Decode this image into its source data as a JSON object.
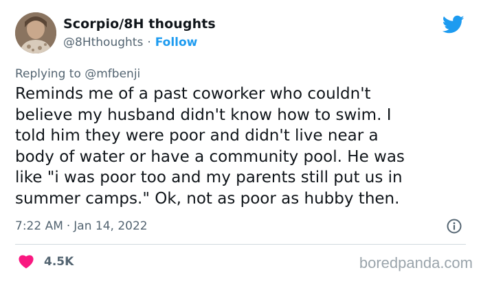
{
  "author": {
    "display_name": "Scorpio/8H thoughts",
    "handle": "@8Hthoughts",
    "separator": "·",
    "follow_label": "Follow",
    "avatar_icon": "profile-avatar"
  },
  "brand": {
    "icon": "twitter-bird-icon",
    "color": "#1d9bf0"
  },
  "reply_context": {
    "prefix": "Replying to",
    "mention": "@mfbenji"
  },
  "tweet": {
    "lines": [
      "Reminds me of a past coworker who couldn't",
      "believe my husband didn't know how to swim. I",
      "told him they were poor and didn't live near a",
      "body of water or have a community pool. He was",
      "like \"i was poor too and my parents still put us in",
      "summer camps.\" Ok, not as poor as hubby then."
    ]
  },
  "meta": {
    "time": "7:22 AM",
    "separator": "·",
    "date": "Jan 14, 2022",
    "info_icon": "info-icon"
  },
  "engagement": {
    "like_icon": "heart-icon",
    "like_color": "#f91880",
    "likes": "4.5K"
  },
  "watermark": {
    "text": "boredpanda.com"
  }
}
